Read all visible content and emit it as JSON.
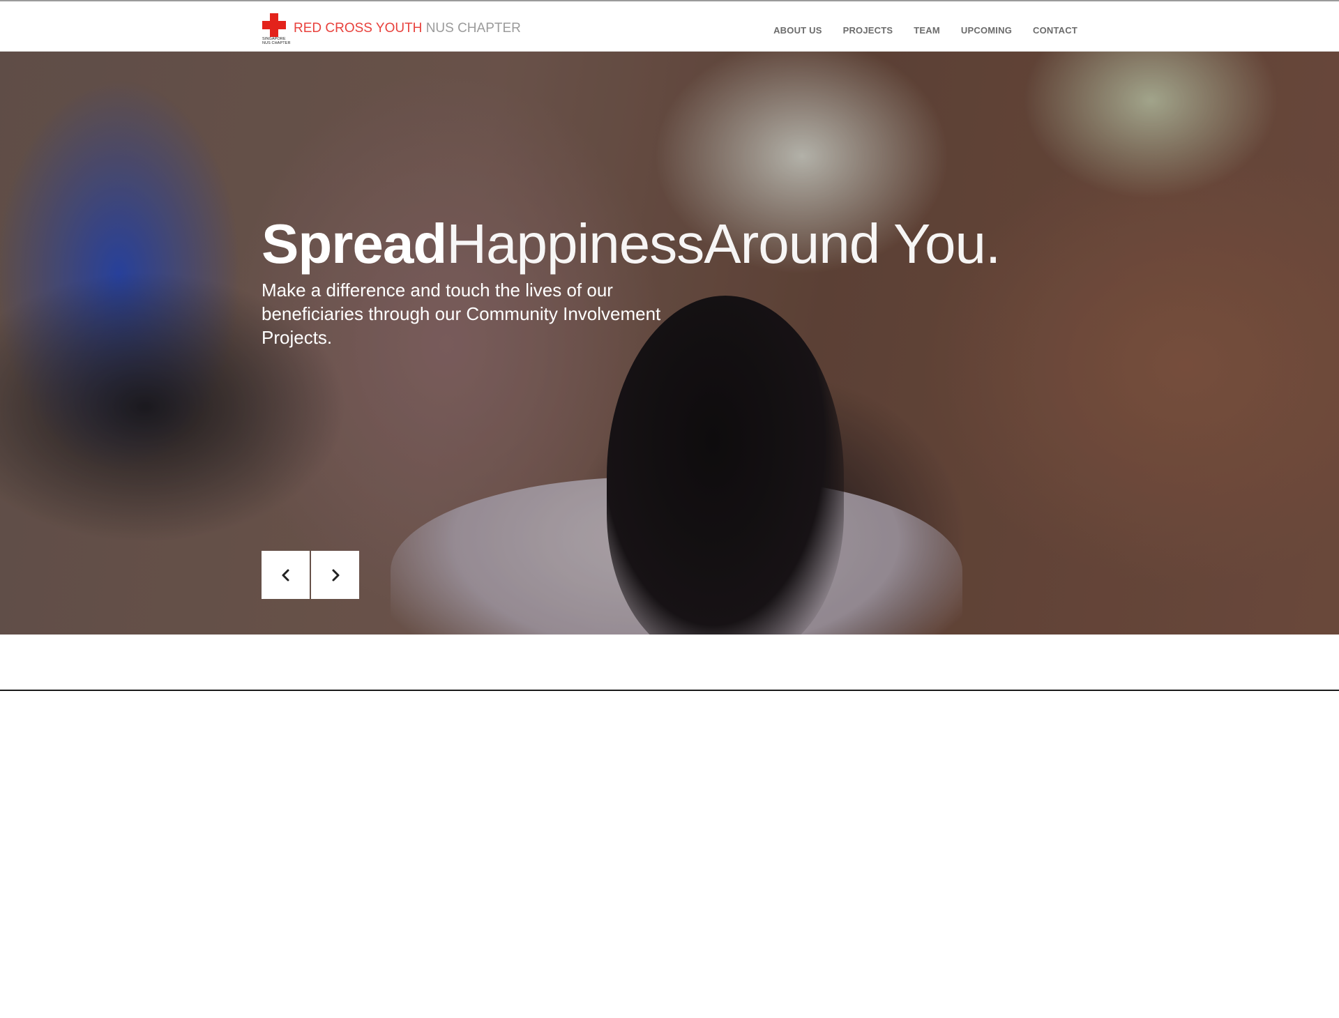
{
  "brand": {
    "name_main": "RED CROSS YOUTH",
    "name_light": "NUS CHAPTER",
    "logo_caption": "SINGAPORE NUS CHAPTER",
    "logo_icon": "red-cross-icon",
    "accent_color": "#e8413c"
  },
  "nav": {
    "items": [
      "ABOUT US",
      "PROJECTS",
      "TEAM",
      "UPCOMING",
      "CONTACT"
    ]
  },
  "hero": {
    "title_bold": "Spread",
    "title_light_1": "Happiness",
    "title_light_2": "Around You.",
    "subtitle": "Make a difference and touch the lives of our beneficiaries through our Community Involvement Projects."
  },
  "slider": {
    "prev_icon": "chevron-left-icon",
    "next_icon": "chevron-right-icon"
  }
}
